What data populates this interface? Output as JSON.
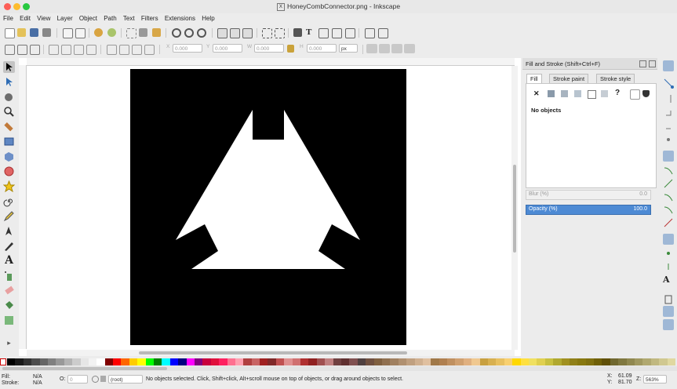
{
  "window": {
    "title": "HoneyCombConnector.png - Inkscape"
  },
  "menu": [
    "File",
    "Edit",
    "View",
    "Layer",
    "Object",
    "Path",
    "Text",
    "Filters",
    "Extensions",
    "Help"
  ],
  "toolbar2": {
    "x_label": "X",
    "x_value": "0.000",
    "y_label": "Y",
    "y_value": "0.000",
    "w_label": "W",
    "w_value": "0.000",
    "h_label": "H",
    "h_value": "0.000",
    "unit": "px"
  },
  "panel": {
    "title": "Fill and Stroke (Shift+Ctrl+F)",
    "tabs": [
      "Fill",
      "Stroke paint",
      "Stroke style"
    ],
    "no_objects": "No objects",
    "blur_label": "Blur (%)",
    "blur_value": "0.0",
    "opacity_label": "Opacity (%)",
    "opacity_value": "100.0",
    "unknown_glyph": "?"
  },
  "status": {
    "fill_label": "Fill:",
    "fill_value": "N/A",
    "stroke_label": "Stroke:",
    "stroke_value": "N/A",
    "o_label": "O:",
    "o_value": "0",
    "layer": "(root)",
    "message": "No objects selected. Click, Shift+click, Alt+scroll mouse on top of objects, or drag around objects to select.",
    "x_label": "X:",
    "x_value": "61.09",
    "y_label": "Y:",
    "y_value": "81.70",
    "z_label": "Z:",
    "zoom": "563%"
  },
  "palette_colors": [
    "#000000",
    "#1a1a1a",
    "#333333",
    "#4d4d4d",
    "#666666",
    "#808080",
    "#999999",
    "#b3b3b3",
    "#cccccc",
    "#e6e6e6",
    "#f2f2f2",
    "#ffffff",
    "#800000",
    "#ff0000",
    "#ff6600",
    "#ffcc00",
    "#ffff00",
    "#00ff00",
    "#008000",
    "#00ffff",
    "#0000ff",
    "#000080",
    "#ff00ff",
    "#800080",
    "#c8003c",
    "#e0103c",
    "#ff2060",
    "#ff7090",
    "#ffa0b0",
    "#b04040",
    "#c86464",
    "#a02020",
    "#802828",
    "#c05050",
    "#e09090",
    "#d07070",
    "#b03030",
    "#902020",
    "#a05050",
    "#c08080",
    "#704040",
    "#603030",
    "#805050",
    "#504040",
    "#705040",
    "#806040",
    "#907050",
    "#a08060",
    "#b09070",
    "#c0a080",
    "#d0b090",
    "#e0c0a0",
    "#a07848",
    "#b08050",
    "#c09060",
    "#d0a070",
    "#e0b080",
    "#f0c890",
    "#c8a040",
    "#d8b050",
    "#e8c060",
    "#f8d070",
    "#ffd800",
    "#ffe040",
    "#f0e060",
    "#e0d050",
    "#c8c040",
    "#b0a830",
    "#a09020",
    "#908018",
    "#887810",
    "#807010",
    "#706008",
    "#605008",
    "#706830",
    "#807840",
    "#908850",
    "#a09860",
    "#b0a870",
    "#c0b880",
    "#d0c890",
    "#e0d8a0"
  ],
  "scrollbar_hint": "▸"
}
